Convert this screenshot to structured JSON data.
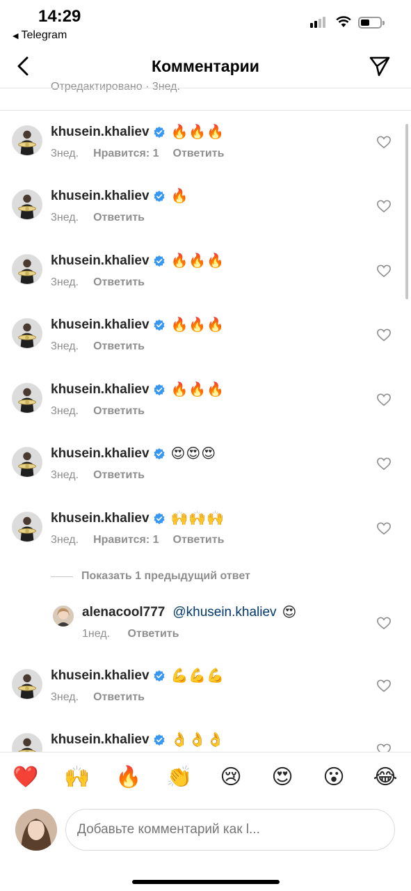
{
  "status_bar": {
    "time": "14:29",
    "back_app": "Telegram"
  },
  "nav": {
    "title": "Комментарии"
  },
  "caption_meta": "Отредактировано · 3нед.",
  "comments": [
    {
      "username": "khusein.khaliev",
      "text": "🔥🔥🔥",
      "date": "3нед.",
      "likes": "Нравится: 1",
      "reply": "Ответить"
    },
    {
      "username": "khusein.khaliev",
      "text": "🔥",
      "date": "3нед.",
      "likes": "",
      "reply": "Ответить"
    },
    {
      "username": "khusein.khaliev",
      "text": "🔥🔥🔥",
      "date": "3нед.",
      "likes": "",
      "reply": "Ответить"
    },
    {
      "username": "khusein.khaliev",
      "text": "🔥🔥🔥",
      "date": "3нед.",
      "likes": "",
      "reply": "Ответить"
    },
    {
      "username": "khusein.khaliev",
      "text": "🔥🔥🔥",
      "date": "3нед.",
      "likes": "",
      "reply": "Ответить"
    },
    {
      "username": "khusein.khaliev",
      "text": "😍😍😍",
      "date": "3нед.",
      "likes": "",
      "reply": "Ответить"
    },
    {
      "username": "khusein.khaliev",
      "text": "🙌🙌🙌",
      "date": "3нед.",
      "likes": "Нравится: 1",
      "reply": "Ответить"
    },
    {
      "username": "khusein.khaliev",
      "text": "💪💪💪",
      "date": "3нед.",
      "likes": "",
      "reply": "Ответить"
    },
    {
      "username": "khusein.khaliev",
      "text": "👌👌👌",
      "date": "",
      "likes": "",
      "reply": ""
    }
  ],
  "previous_replies": "Показать 1 предыдущий ответ",
  "reply": {
    "username": "alenacool777",
    "mention": "@khusein.khaliev",
    "emoji": "😍",
    "date": "1нед.",
    "reply": "Ответить"
  },
  "quick_emojis": [
    "❤️",
    "🙌",
    "🔥",
    "👏",
    "😢",
    "😍",
    "😮",
    "😂"
  ],
  "composer": {
    "placeholder": "Добавьте комментарий как l..."
  },
  "colors": {
    "verified": "#3897f0",
    "mention": "#00376b",
    "muted": "#8e8e8e"
  }
}
